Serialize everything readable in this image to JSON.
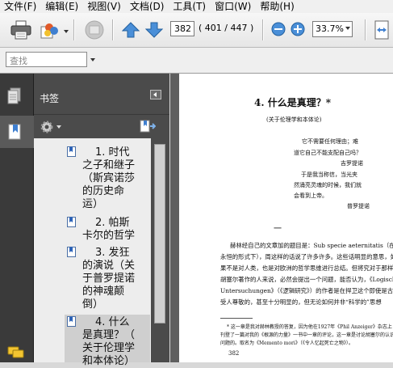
{
  "menu": [
    {
      "label": "文件(F)"
    },
    {
      "label": "编辑(E)"
    },
    {
      "label": "视图(V)"
    },
    {
      "label": "文档(D)"
    },
    {
      "label": "工具(T)"
    },
    {
      "label": "窗口(W)"
    },
    {
      "label": "帮助(H)"
    }
  ],
  "toolbar": {
    "current_page": "382",
    "page_count": "( 401 / 447 )",
    "zoom": "33.7%"
  },
  "search": {
    "placeholder": "查找"
  },
  "panel": {
    "title": "书签"
  },
  "bookmarks": [
    {
      "lines": [
        "1. 时代",
        "之子和继子",
        "（斯宾诺莎",
        "的历史命",
        "运）"
      ]
    },
    {
      "lines": [
        "2. 帕斯",
        "卡尔的哲学"
      ]
    },
    {
      "lines": [
        "3. 发狂",
        "的演说（关",
        "于普罗提诺",
        "的神魂颠",
        "倒）"
      ]
    },
    {
      "lines": [
        "4. 什么",
        "是真理？（",
        "关于伦理学",
        "和本体论）"
      ],
      "selected": true
    }
  ],
  "document": {
    "chapter_title": "4. 什么是真理？*",
    "chapter_subtitle": "(关于伦理学和本体论)",
    "epigraph_1": [
      "它不需要任何理由；难",
      "道它自己不能支配自己吗？",
      "吉罗提诺"
    ],
    "epigraph_2": [
      "于是我当称信，当光夹",
      "然涌亮灵魂的时候，我们就",
      "会看到上帝。",
      "普罗提诺"
    ],
    "section_mark": "一",
    "body_lines": [
      "赫林经自己的文章加的题目是：Sub specie aeternitatis（在",
      "永恒的形式下），周这样的话说了许多许多。这些话明显的意思，如",
      "果不是对人类，也是对欧洲的哲学思维进行总结。但将究对于那样",
      "胡塞尔著作的人来说，必然会提出一个问题，能否认为，《Logische",
      "Untersuchungen》（《逻辑研究》）的作者是在捍卫这个即使是古代",
      "受人尊敬的，甚至十分明显的，但无论如何并非“科学的”思想"
    ],
    "footnote_lines": [
      "* 这一章是我对赫林教授的答复，因为他在1927年《Phil Anzeiger》杂志上",
      "刊登了一篇对我的《根源的力量》一书中一章的评论，这一章是讨论胡塞尔的认识论学",
      "问题的。取名为《Memento mori》（《令人忆起死亡之物》）。"
    ],
    "page_number": "382"
  }
}
